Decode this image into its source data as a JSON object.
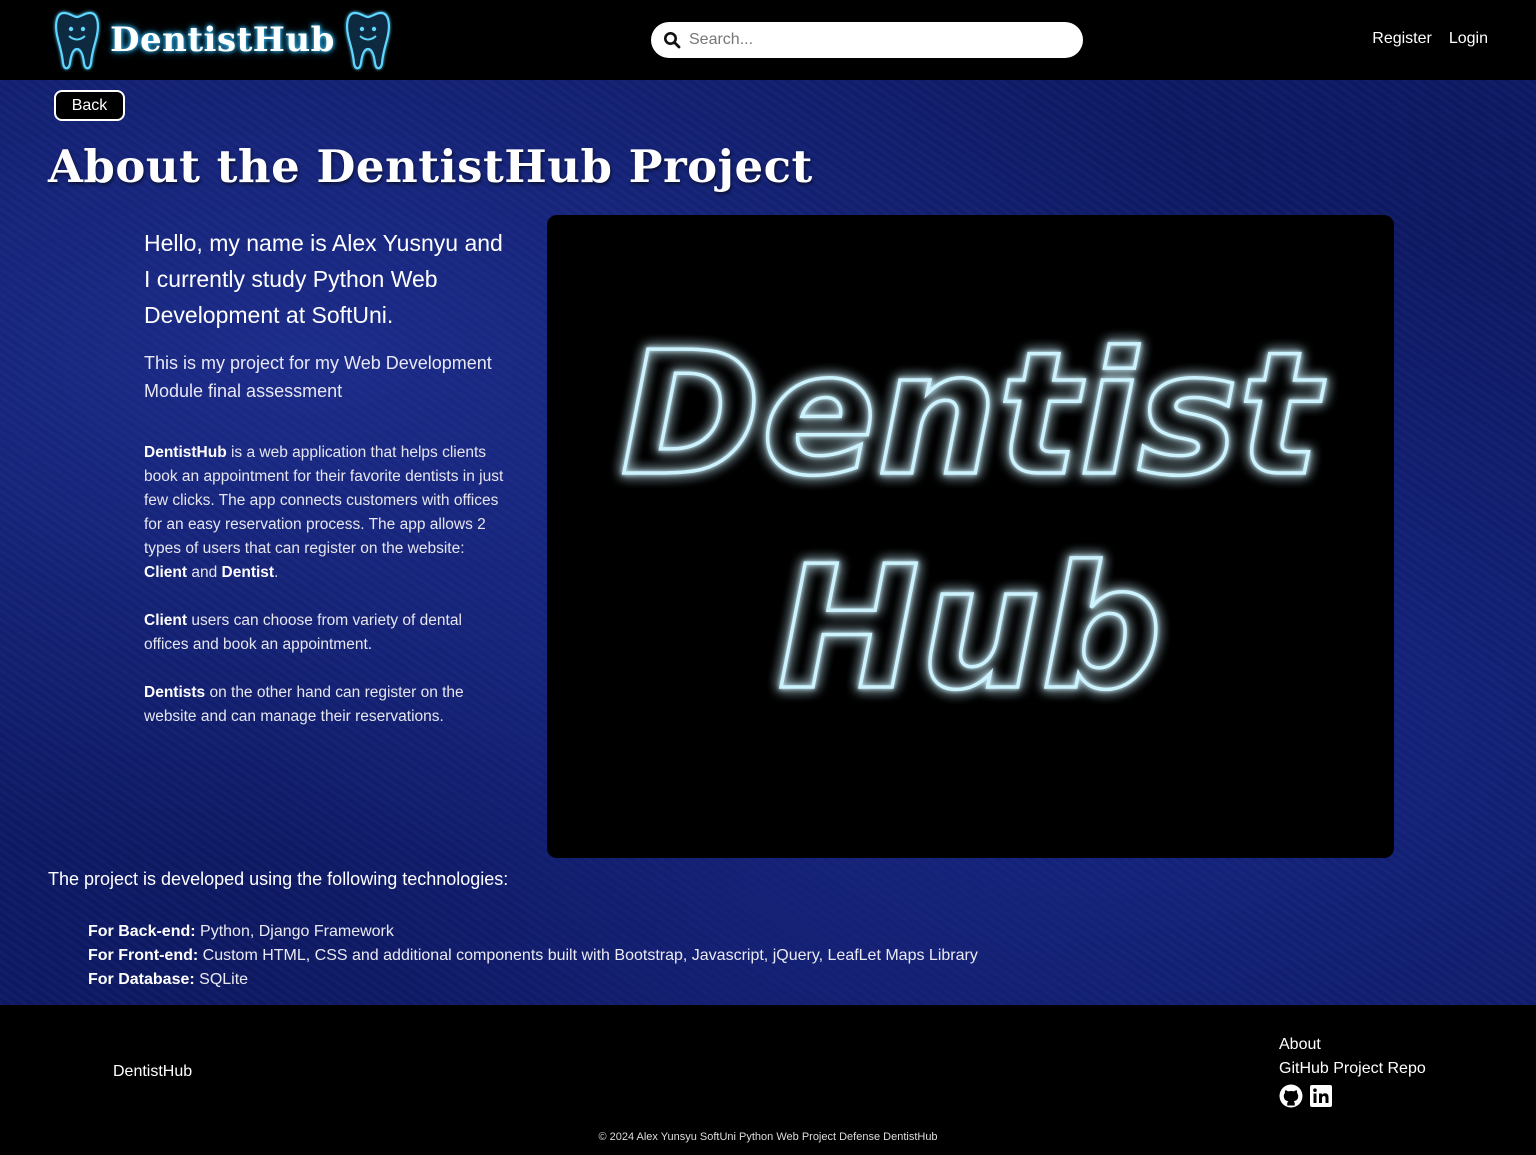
{
  "header": {
    "brand": "DentistHub",
    "search_placeholder": "Search...",
    "nav": {
      "register": "Register",
      "login": "Login"
    }
  },
  "main": {
    "back_label": "Back",
    "title": "About the DentistHub Project",
    "intro": "Hello, my name is Alex Yusnyu and I currently study Python Web Development at SoftUni.",
    "subintro": "This is my project for my Web Development Module final assessment",
    "desc1": {
      "bold1": "DentistHub",
      "t1": " is a web application that helps clients book an appointment for their favorite dentists in just few clicks. The app connects customers with offices for an easy reservation process. The app allows 2 types of users that can register on the website: ",
      "bold2": "Client",
      "t2": " and ",
      "bold3": "Dentist",
      "t3": "."
    },
    "desc2": {
      "bold": "Client",
      "text": " users can choose from variety of dental offices and book an appointment."
    },
    "desc3": {
      "bold": "Dentists",
      "text": " on the other hand can register on the website and can manage their reservations."
    },
    "logo": {
      "line1": "Dentist",
      "line2": "Hub"
    },
    "tech_intro": "The project is developed using the following technologies:",
    "tech": [
      {
        "label": "For Back-end:",
        "value": " Python, Django Framework"
      },
      {
        "label": "For Front-end:",
        "value": " Custom HTML, CSS and additional components built with Bootstrap, Javascript, jQuery, LeafLet Maps Library"
      },
      {
        "label": "For Database:",
        "value": " SQLite"
      }
    ]
  },
  "footer": {
    "brand": "DentistHub",
    "links": {
      "about": "About",
      "repo": "GitHub Project Repo"
    },
    "icons": [
      "github-icon",
      "linkedin-icon"
    ],
    "copyright": "© 2024 Alex Yunsyu SoftUni Python Web Project Defense DentistHub"
  },
  "colors": {
    "glow": "#3cc8ff",
    "background_blue": "#0e1a66"
  }
}
